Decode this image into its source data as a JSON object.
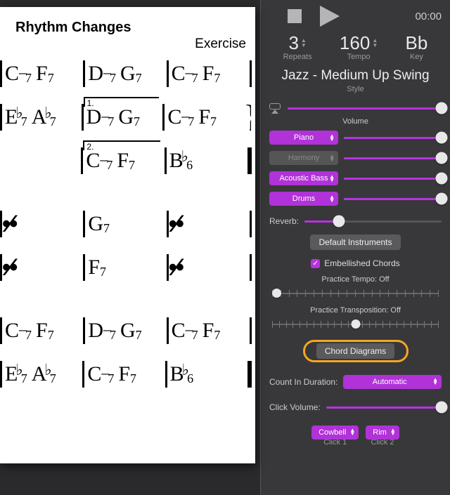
{
  "sheet": {
    "title": "Rhythm Changes",
    "type_label": "Exercise",
    "rows": [
      [
        [
          "C",
          "-7",
          "F",
          "7"
        ],
        [
          "D",
          "-7",
          "G",
          "7"
        ],
        [
          "C",
          "-7",
          "F",
          "7"
        ]
      ],
      [
        [
          "E♭",
          "7",
          "A♭",
          "7"
        ],
        [
          "D",
          "-7",
          "G",
          "7",
          "1."
        ],
        [
          "C",
          "-7",
          "F",
          "7"
        ]
      ],
      [
        null,
        [
          "C",
          "-7",
          "F",
          "7",
          "2."
        ],
        [
          "B♭",
          "6"
        ]
      ],
      [
        [
          "/"
        ],
        [
          "G",
          "7"
        ],
        [
          "/"
        ]
      ],
      [
        [
          "/"
        ],
        [
          "F",
          "7"
        ],
        [
          "/"
        ]
      ],
      [
        [
          "C",
          "-7",
          "F",
          "7"
        ],
        [
          "D",
          "-7",
          "G",
          "7"
        ],
        [
          "C",
          "-7",
          "F",
          "7"
        ]
      ],
      [
        [
          "E♭",
          "7",
          "A♭",
          "7"
        ],
        [
          "C",
          "-7",
          "F",
          "7"
        ],
        [
          "B♭",
          "6"
        ]
      ]
    ]
  },
  "panel": {
    "timecode": "00:00",
    "repeats": {
      "value": "3",
      "label": "Repeats"
    },
    "tempo": {
      "value": "160",
      "label": "Tempo"
    },
    "key": {
      "value": "Bb",
      "label": "Key"
    },
    "style_name": "Jazz - Medium Up Swing",
    "style_sub": "Style",
    "volume_label": "Volume",
    "instruments": [
      {
        "name": "Piano",
        "enabled": true,
        "level": 100
      },
      {
        "name": "Harmony",
        "enabled": false,
        "level": 100
      },
      {
        "name": "Acoustic Bass",
        "enabled": true,
        "level": 100
      },
      {
        "name": "Drums",
        "enabled": true,
        "level": 100
      }
    ],
    "reverb_label": "Reverb:",
    "reverb_level": 25,
    "default_instruments_btn": "Default Instruments",
    "embellished_label": "Embellished Chords",
    "practice_tempo_label": "Practice Tempo: Off",
    "practice_transposition_label": "Practice Transposition: Off",
    "chord_diagrams_btn": "Chord Diagrams",
    "count_in_label": "Count In Duration:",
    "count_in_value": "Automatic",
    "click_volume_label": "Click Volume:",
    "click_volume_level": 100,
    "click1": {
      "value": "Cowbell",
      "label": "Click 1"
    },
    "click2": {
      "value": "Rim",
      "label": "Click 2"
    }
  }
}
